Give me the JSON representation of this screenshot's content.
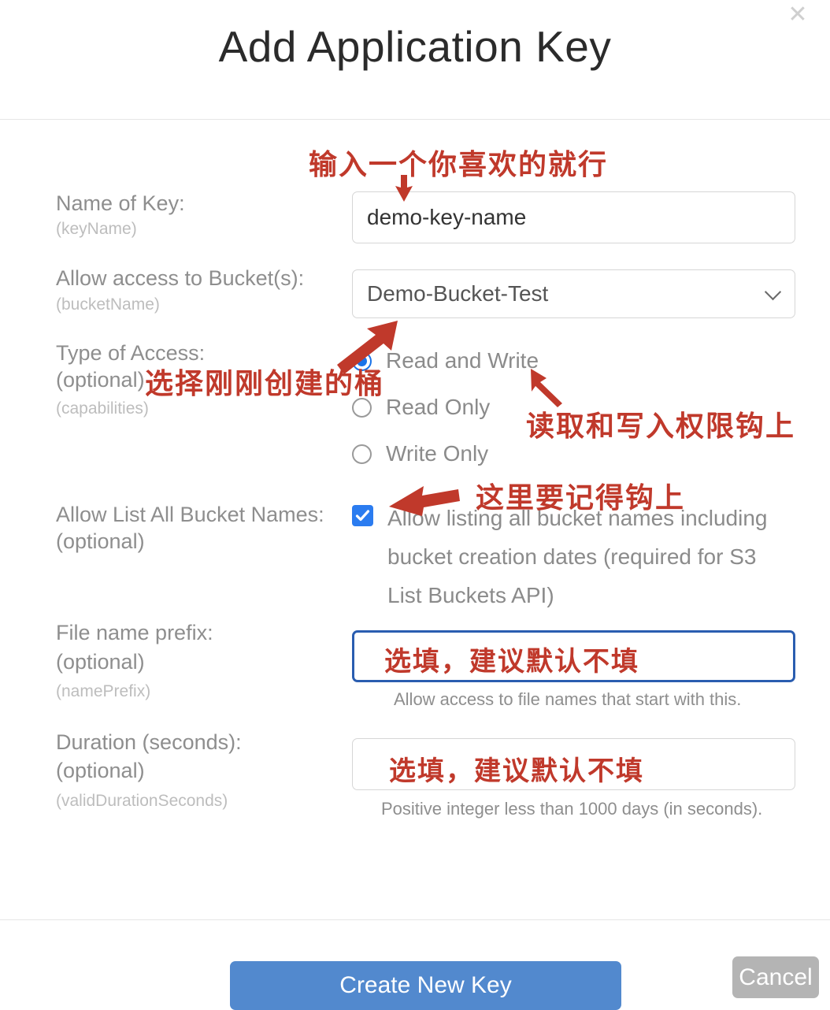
{
  "dialog": {
    "title": "Add Application Key",
    "close_icon": "close-icon",
    "cancel_label": "Cancel",
    "submit_label": "Create New Key"
  },
  "fields": {
    "key_name": {
      "label": "Name of Key:",
      "sublabel": "(keyName)",
      "value": "demo-key-name"
    },
    "bucket": {
      "label": "Allow access to Bucket(s):",
      "sublabel": "(bucketName)",
      "value": "Demo-Bucket-Test",
      "chevron_icon": "chevron-down-icon"
    },
    "access_type": {
      "label": "Type of Access:",
      "label2": "(optional)",
      "sublabel": "(capabilities)",
      "options": [
        {
          "label": "Read and Write",
          "selected": true
        },
        {
          "label": "Read Only",
          "selected": false
        },
        {
          "label": "Write Only",
          "selected": false
        }
      ]
    },
    "list_all_buckets": {
      "label": "Allow List All Bucket Names:",
      "label2": "(optional)",
      "checkbox_label": "Allow listing all bucket names including bucket creation dates (required for S3 List Buckets API)",
      "checked": true,
      "check_icon": "check-icon"
    },
    "name_prefix": {
      "label": "File name prefix:",
      "label2": "(optional)",
      "sublabel": "(namePrefix)",
      "value": "",
      "help": "Allow access to file names that start with this.",
      "focused": true
    },
    "duration": {
      "label": "Duration (seconds):",
      "label2": "(optional)",
      "sublabel": "(validDurationSeconds)",
      "value": "",
      "help": "Positive integer less than 1000 days (in seconds)."
    }
  },
  "annotations": {
    "color": "#c0392b",
    "items": [
      {
        "name": "annotation-key-name",
        "text": "输入一个你喜欢的就行",
        "arrow": "arrow-down"
      },
      {
        "name": "annotation-select-bucket",
        "text": "选择刚刚创建的桶",
        "arrow": "arrow-up-right"
      },
      {
        "name": "annotation-read-write",
        "text": "读取和写入权限钩上",
        "arrow": "arrow-up-left"
      },
      {
        "name": "annotation-check-here",
        "text": "这里要记得钩上",
        "arrow": "arrow-left"
      },
      {
        "name": "annotation-name-prefix-optional",
        "text": "选填，建议默认不填",
        "arrow": "none"
      },
      {
        "name": "annotation-duration-optional",
        "text": "选填，建议默认不填",
        "arrow": "none"
      }
    ]
  },
  "colors": {
    "primary_button": "#5289ce",
    "cancel_button": "#b4b4b4",
    "radio_selected": "#1a73e8",
    "checkbox": "#2b7cf0",
    "focus_border": "#2a5db0",
    "annotation_red": "#c0392b"
  }
}
